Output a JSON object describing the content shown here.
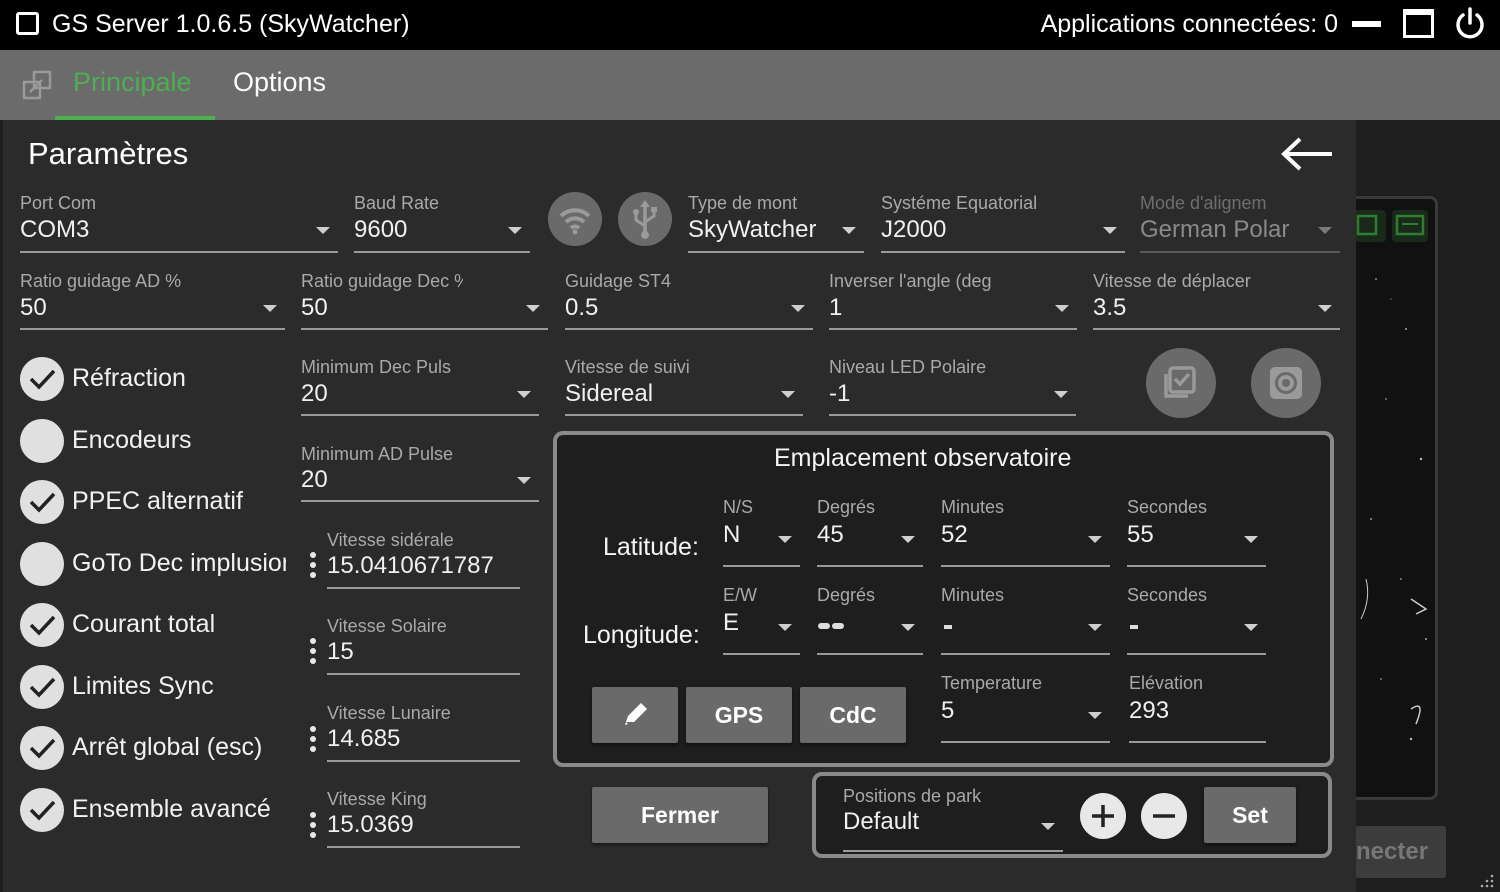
{
  "window": {
    "title": "GS Server 1.0.6.5 (SkyWatcher)",
    "connected_apps": "Applications connectées: 0"
  },
  "tabs": [
    {
      "label": "Principale",
      "active": true
    },
    {
      "label": "Options",
      "active": false
    }
  ],
  "panel": {
    "title": "Paramètres"
  },
  "fields": {
    "port_com": {
      "label": "Port Com",
      "value": "COM3"
    },
    "baud_rate": {
      "label": "Baud Rate",
      "value": "9600"
    },
    "mount_type": {
      "label": "Type de mont",
      "value": "SkyWatcher"
    },
    "eq_system": {
      "label": "Systéme Equatorial",
      "value": "J2000"
    },
    "align_mode": {
      "label": "Mode d'alignem",
      "value": "German Polar"
    },
    "guide_ra": {
      "label": "Ratio guidage AD %",
      "value": "50"
    },
    "guide_dec": {
      "label": "Ratio guidage Dec %",
      "value": "50"
    },
    "guide_st4": {
      "label": "Guidage ST4",
      "value": "0.5"
    },
    "invert_angle": {
      "label": "Inverser l'angle (deg",
      "value": "1"
    },
    "move_speed": {
      "label": "Vitesse de déplacer",
      "value": "3.5"
    },
    "min_dec_pulse": {
      "label": "Minimum Dec Puls",
      "value": "20"
    },
    "tracking_speed": {
      "label": "Vitesse de suivi",
      "value": "Sidereal"
    },
    "polar_led": {
      "label": "Niveau LED Polaire",
      "value": "-1"
    },
    "min_ra_pulse": {
      "label": "Minimum AD Pulse",
      "value": "20"
    },
    "sidereal_rate": {
      "label": "Vitesse sidérale",
      "value": "15.0410671787"
    },
    "solar_rate": {
      "label": "Vitesse Solaire",
      "value": "15"
    },
    "lunar_rate": {
      "label": "Vitesse Lunaire",
      "value": "14.685"
    },
    "king_rate": {
      "label": "Vitesse King",
      "value": "15.0369"
    }
  },
  "checkboxes": [
    {
      "label": "Réfraction",
      "checked": true
    },
    {
      "label": "Encodeurs",
      "checked": false
    },
    {
      "label": "PPEC alternatif",
      "checked": true
    },
    {
      "label": "GoTo Dec implusion",
      "checked": false
    },
    {
      "label": "Courant total",
      "checked": true
    },
    {
      "label": "Limites Sync",
      "checked": true
    },
    {
      "label": "Arrêt global (esc)",
      "checked": true
    },
    {
      "label": "Ensemble avancé",
      "checked": true
    }
  ],
  "observatory": {
    "title": "Emplacement observatoire",
    "latitude_label": "Latitude:",
    "longitude_label": "Longitude:",
    "lat": {
      "ns": {
        "label": "N/S",
        "value": "N"
      },
      "deg": {
        "label": "Degrés",
        "value": "45"
      },
      "min": {
        "label": "Minutes",
        "value": "52"
      },
      "sec": {
        "label": "Secondes",
        "value": "55"
      }
    },
    "lon": {
      "ew": {
        "label": "E/W",
        "value": "E"
      },
      "deg": {
        "label": "Degrés",
        "value": ""
      },
      "min": {
        "label": "Minutes",
        "value": ""
      },
      "sec": {
        "label": "Secondes",
        "value": ""
      }
    },
    "gps_label": "GPS",
    "cdc_label": "CdC",
    "temperature": {
      "label": "Temperature",
      "value": "5"
    },
    "elevation": {
      "label": "Elévation",
      "value": "293"
    }
  },
  "buttons": {
    "close_label": "Fermer",
    "set_label": "Set",
    "connect_label": "necter"
  },
  "park": {
    "label": "Positions de park",
    "value": "Default"
  },
  "colors": {
    "accent": "#4caf50",
    "panel": "#2b2b2b",
    "tabbar": "#6b6b6b"
  }
}
